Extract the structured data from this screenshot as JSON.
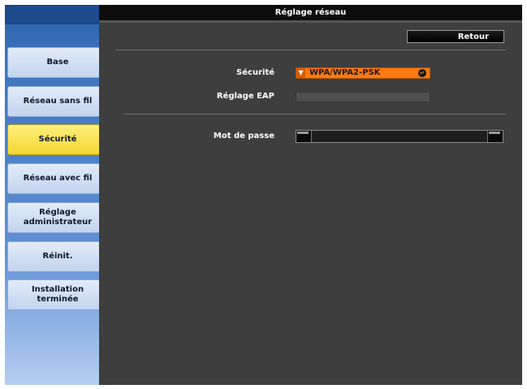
{
  "title": "Réglage réseau",
  "back_button": "Retour",
  "sidebar": {
    "items": [
      {
        "label": "Base",
        "active": false
      },
      {
        "label": "Réseau sans fil",
        "active": false
      },
      {
        "label": "Sécurité",
        "active": true
      },
      {
        "label": "Réseau avec fil",
        "active": false
      },
      {
        "label": "Réglage\nadministrateur",
        "active": false
      },
      {
        "label": "Réinit.",
        "active": false
      },
      {
        "label": "Installation\nterminée",
        "active": false
      }
    ]
  },
  "settings": {
    "security_label": "Sécurité",
    "security_value": "WPA/WPA2-PSK",
    "eap_label": "Réglage EAP",
    "eap_value": "",
    "password_label": "Mot de passe",
    "password_value": ""
  },
  "colors": {
    "accent_orange": "#ff7a12",
    "active_tab_yellow": "#f4d634",
    "panel_bg": "#3e3e3e",
    "sidebar_blue": "#3c72bd"
  }
}
